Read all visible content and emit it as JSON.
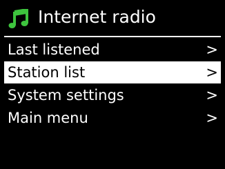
{
  "header": {
    "icon": "music-note-icon",
    "title": "Internet radio",
    "icon_color": "#3ec43e"
  },
  "menu": {
    "items": [
      {
        "label": "Last listened",
        "arrow": ">",
        "selected": false
      },
      {
        "label": "Station list",
        "arrow": ">",
        "selected": true
      },
      {
        "label": "System settings",
        "arrow": ">",
        "selected": false
      },
      {
        "label": "Main menu",
        "arrow": ">",
        "selected": false
      }
    ]
  }
}
